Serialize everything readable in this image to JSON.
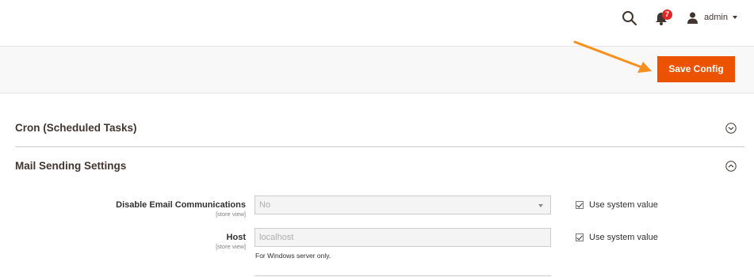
{
  "header": {
    "notifications_count": "7",
    "user_name": "admin"
  },
  "actions": {
    "save_label": "Save Config"
  },
  "sections": [
    {
      "title": "Cron (Scheduled Tasks)",
      "expanded": false
    },
    {
      "title": "Mail Sending Settings",
      "expanded": true
    }
  ],
  "fields": [
    {
      "label": "Disable Email Communications",
      "scope": "[store view]",
      "type": "select",
      "value": "No",
      "use_system_value_label": "Use system value",
      "use_system_value_checked": true
    },
    {
      "label": "Host",
      "scope": "[store view]",
      "type": "text",
      "placeholder": "localhost",
      "note": "For Windows server only.",
      "use_system_value_label": "Use system value",
      "use_system_value_checked": true
    }
  ],
  "colors": {
    "accent": "#eb5202",
    "badge": "#e22626",
    "annotation_arrow": "#f7901e"
  },
  "icons": [
    "search-icon",
    "bell-icon",
    "user-icon",
    "caret-down-icon",
    "chevron-down-circle-icon",
    "chevron-up-circle-icon",
    "checkbox-icon"
  ]
}
